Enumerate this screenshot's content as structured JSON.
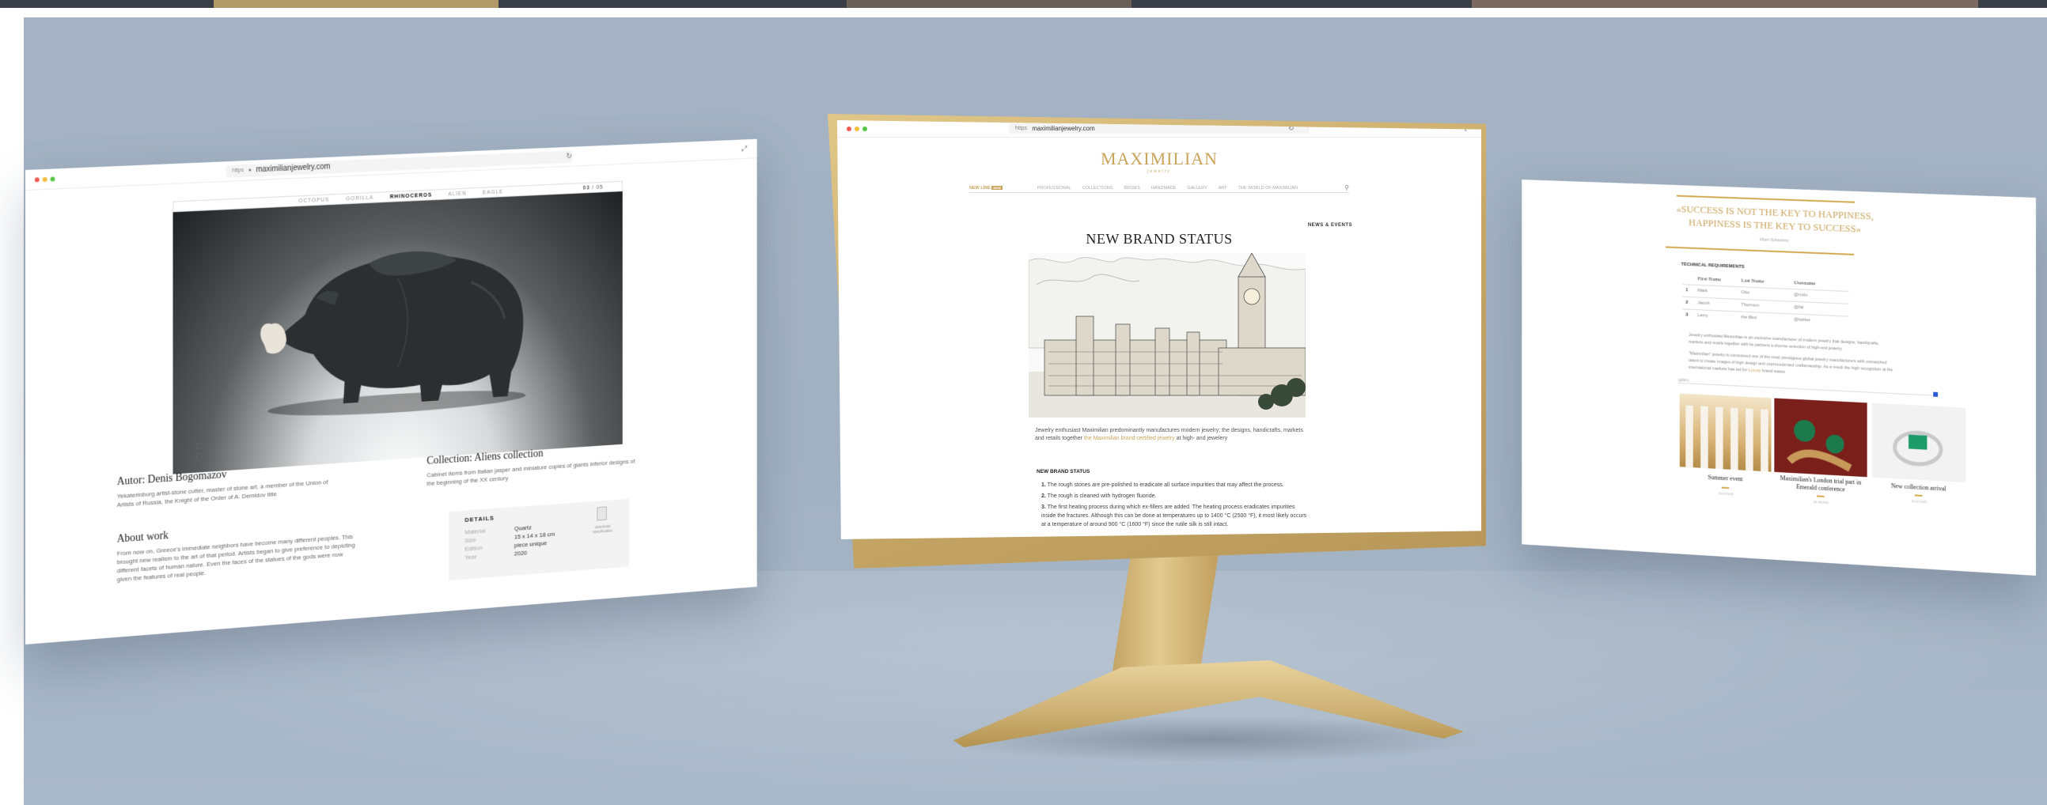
{
  "screens": {
    "left": {
      "url": "maximilianjewelry.com",
      "url_prefix": "https",
      "nav_tabs": [
        "OCTOPUS",
        "GORILLA",
        "RHINOCEROS",
        "ALIEN",
        "EAGLE"
      ],
      "active_tab": "RHINOCEROS",
      "pager": {
        "current": "03",
        "total": "05"
      },
      "author_heading": "Autor: Denis Bogomazov",
      "author_bio": "Yekaterinburg artist-stone cutter, master of stone art, a member of the Union of Artists of Russia, the Knight of the Order of A. Demidov title",
      "collection_heading": "Collection: Aliens collection",
      "collection_desc": "Cabinet items from Italian jasper and miniature copies of giants inferior designs of the beginning of the XX century",
      "about_heading": "About work",
      "about_text": "From now on, Greece's immediate neighbors have become many different peoples. This brought new realism to the art of that period. Artists began to give preference to depicting different facets of human nature. Even the faces of the statues of the gods were now given the features of real people.",
      "details_heading": "DETAILS",
      "details": [
        {
          "label": "Material",
          "value": "Quartz"
        },
        {
          "label": "Size",
          "value": "15 x 14 x 18 cm"
        },
        {
          "label": "Edition",
          "value": "piece unique"
        },
        {
          "label": "Year",
          "value": "2020"
        }
      ],
      "file_label": "download specification"
    },
    "middle": {
      "url": "maximilianjewelry.com",
      "url_prefix": "https",
      "logo": "MAXIMILIAN",
      "logo_sub": "jewelry",
      "nav": [
        "NEW LINE",
        "PROFESSIONAL",
        "COLLECTIONS",
        "BRIDES",
        "HANDMADE",
        "GALLERY",
        "ART",
        "THE WORLD OF MAXIMILIAN"
      ],
      "nav_badge": "NEW",
      "section_tag": "NEWS & EVENTS",
      "title": "NEW BRAND STATUS",
      "intro": "Jewelry enthusiast Maximilian predominantly manufactures modern jewelry; the designs, handicrafts, markets and retails together",
      "intro_link": "the Maximilian brand certified jewelry",
      "intro_tail": "at high- and jewelery",
      "subheading": "NEW BRAND STATUS",
      "steps": [
        "The rough stones are pre-polished to eradicate all surface impurities that may affect the process.",
        "The rough is cleaned with hydrogen fluoride.",
        "The first heating process during which ex-fillers are added. The heating process eradicates impurities inside the fractures. Although this can be done at temperatures up to 1400 °C (2500 °F), it most likely occurs at a temperature of around 900 °C (1600 °F) since the rutile silk is still intact."
      ]
    },
    "right": {
      "quote": "«SUCCESS IS NOT THE KEY TO HAPPINESS, HAPPINESS IS THE KEY TO SUCCESS»",
      "quote_author": "Albert Schweitzer",
      "table_title": "TECHNICAL REQUIREMENTS",
      "table_headers": [
        "First Name",
        "Last Name",
        "Username"
      ],
      "table_rows": [
        {
          "num": "1",
          "first": "Mark",
          "last": "Otto",
          "user": "@mdo"
        },
        {
          "num": "2",
          "first": "Jacob",
          "last": "Thornton",
          "user": "@fat"
        },
        {
          "num": "3",
          "first": "Larry",
          "last": "the Bird",
          "user": "@twitter"
        }
      ],
      "para1": "Jewelry enthusiast Maximilian is an exclusive manufacturer of modern jewelry that designs, handicrafts, markets and retails together with its partners a diverse selection of high-end jewelry.",
      "para2": "\"Maximilian\" jewelry is considered one of the most prestigious global jewelry manufacturers with unmatched talent to create images of high design and unprecedented craftsmanship. As a result the high recognition at the international markets has led for",
      "para2_link": "Luxury",
      "para2_tail": "brand status.",
      "gallery_label": "gallery",
      "cards": [
        {
          "title": "Summer event",
          "date": "20.05.2021"
        },
        {
          "title": "Maximilian's London trial part in Emerald conference",
          "date": "04.08.2021"
        },
        {
          "title": "New collection arrival",
          "date": "01.07.2021"
        }
      ]
    }
  },
  "colors": {
    "backdrop": "#a4b2c3",
    "gold": "#c9a45b",
    "monitor_gold": "#d6bc7c"
  },
  "icons": [
    "reload-icon",
    "expand-icon",
    "search-icon",
    "file-icon",
    "image-gallery-icon"
  ]
}
